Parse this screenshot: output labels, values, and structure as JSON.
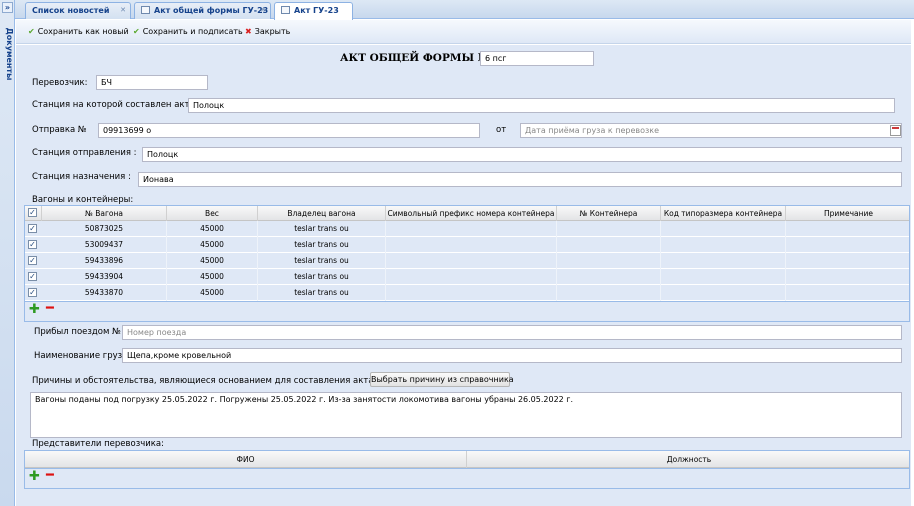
{
  "sidebar": {
    "label": "Документы",
    "expand_glyph": "»"
  },
  "tabs": [
    {
      "label": "Список новостей",
      "icon": "list-icon"
    },
    {
      "label": "Акт общей формы ГУ-23",
      "icon": "form-icon"
    },
    {
      "label": "Акт ГУ-23",
      "icon": "form-icon"
    }
  ],
  "toolbar": {
    "save_new": "Сохранить как новый",
    "save_sign": "Сохранить и подписать",
    "close": "Закрыть"
  },
  "form": {
    "title": "АКТ ОБЩЕЙ ФОРМЫ №",
    "act_number": "6 псг",
    "carrier_label": "Перевозчик:",
    "carrier_value": "БЧ",
    "station_act_label": "Станция на которой составлен акт :",
    "station_act_value": "Полоцк",
    "shipment_label": "Отправка №",
    "shipment_value": "09913699 о",
    "from_label": "от",
    "date_placeholder": "Дата приёма груза к перевозке",
    "departure_label": "Станция отправления :",
    "departure_value": "Полоцк",
    "destination_label": "Станция назначения :",
    "destination_value": "Ионава",
    "wagons_label": "Вагоны и контейнеры:",
    "arrived_label": "Прибыл поездом №:",
    "train_placeholder": "Номер поезда",
    "cargo_label": "Наименование груза:",
    "cargo_value": "Щепа,кроме кровельной",
    "reasons_label": "Причины и обстоятельства, являющиеся основанием для составления акта :",
    "choose_reason_button": "Выбрать причину из справочника",
    "reasons_text": "Вагоны поданы под погрузку 25.05.2022 г. Погружены 25.05.2022 г. Из-за занятости локомотива вагоны убраны  26.05.2022 г.",
    "reps_label": "Представители перевозчика:"
  },
  "wagons_table": {
    "columns": [
      "№ Вагона",
      "Вес",
      "Владелец вагона",
      "Символьный префикс номера контейнера",
      "№ Контейнера",
      "Код типоразмера контейнера",
      "Примечание"
    ],
    "rows": [
      [
        "50873025",
        "45000",
        "teslar trans ou",
        "",
        "",
        "",
        ""
      ],
      [
        "53009437",
        "45000",
        "teslar trans ou",
        "",
        "",
        "",
        ""
      ],
      [
        "59433896",
        "45000",
        "teslar trans ou",
        "",
        "",
        "",
        ""
      ],
      [
        "59433904",
        "45000",
        "teslar trans ou",
        "",
        "",
        "",
        ""
      ],
      [
        "59433870",
        "45000",
        "teslar trans ou",
        "",
        "",
        "",
        ""
      ]
    ]
  },
  "reps_table": {
    "columns": [
      "ФИО",
      "Должность"
    ]
  }
}
